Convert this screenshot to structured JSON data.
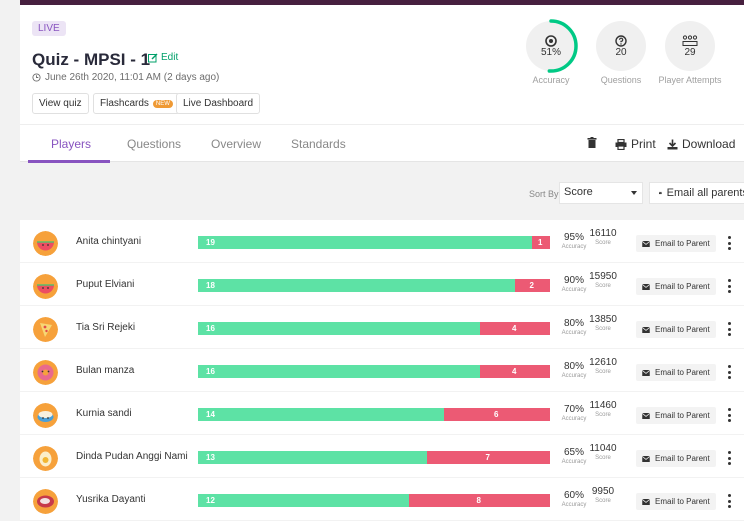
{
  "header": {
    "badge": "LIVE",
    "title": "Quiz - MPSI - 1",
    "edit_label": "Edit",
    "date": "June 26th 2020, 11:01 AM (2 days ago)",
    "buttons": {
      "view_quiz": "View quiz",
      "flashcards": "Flashcards",
      "new_tag": "NEW",
      "live_dashboard": "Live Dashboard"
    }
  },
  "stats": {
    "accuracy": {
      "value": "51%",
      "label": "Accuracy",
      "fraction": 0.51
    },
    "questions": {
      "value": "20",
      "label": "Questions"
    },
    "attempts": {
      "value": "29",
      "label": "Player Attempts"
    }
  },
  "tabs": [
    "Players",
    "Questions",
    "Overview",
    "Standards"
  ],
  "toolbar": {
    "print": "Print",
    "download": "Download"
  },
  "sort": {
    "label": "Sort By:",
    "value": "Score"
  },
  "email_all": "Email all parents",
  "row_labels": {
    "accuracy": "Accuracy",
    "score": "Score",
    "email": "Email to Parent"
  },
  "players": [
    {
      "name": "Anita chintyani",
      "correct": 19,
      "incorrect": 1,
      "accuracy": "95%",
      "score": "16110",
      "avatar": "watermelon-avatar"
    },
    {
      "name": "Puput Elviani",
      "correct": 18,
      "incorrect": 2,
      "accuracy": "90%",
      "score": "15950",
      "avatar": "watermelon-avatar"
    },
    {
      "name": "Tia Sri Rejeki",
      "correct": 16,
      "incorrect": 4,
      "accuracy": "80%",
      "score": "13850",
      "avatar": "pizza-avatar"
    },
    {
      "name": "Bulan manza",
      "correct": 16,
      "incorrect": 4,
      "accuracy": "80%",
      "score": "12610",
      "avatar": "donut-avatar"
    },
    {
      "name": "Kurnia sandi",
      "correct": 14,
      "incorrect": 6,
      "accuracy": "70%",
      "score": "11460",
      "avatar": "sushi-avatar"
    },
    {
      "name": "Dinda Pudan Anggi Nami",
      "correct": 13,
      "incorrect": 7,
      "accuracy": "65%",
      "score": "11040",
      "avatar": "egg-avatar"
    },
    {
      "name": "Yusrika Dayanti",
      "correct": 12,
      "incorrect": 8,
      "accuracy": "60%",
      "score": "9950",
      "avatar": "meat-avatar"
    }
  ],
  "colors": {
    "brand": "#8854c0",
    "correct": "#5de2a5",
    "incorrect": "#ec5a74",
    "accuracy_ring": "#00c985"
  }
}
